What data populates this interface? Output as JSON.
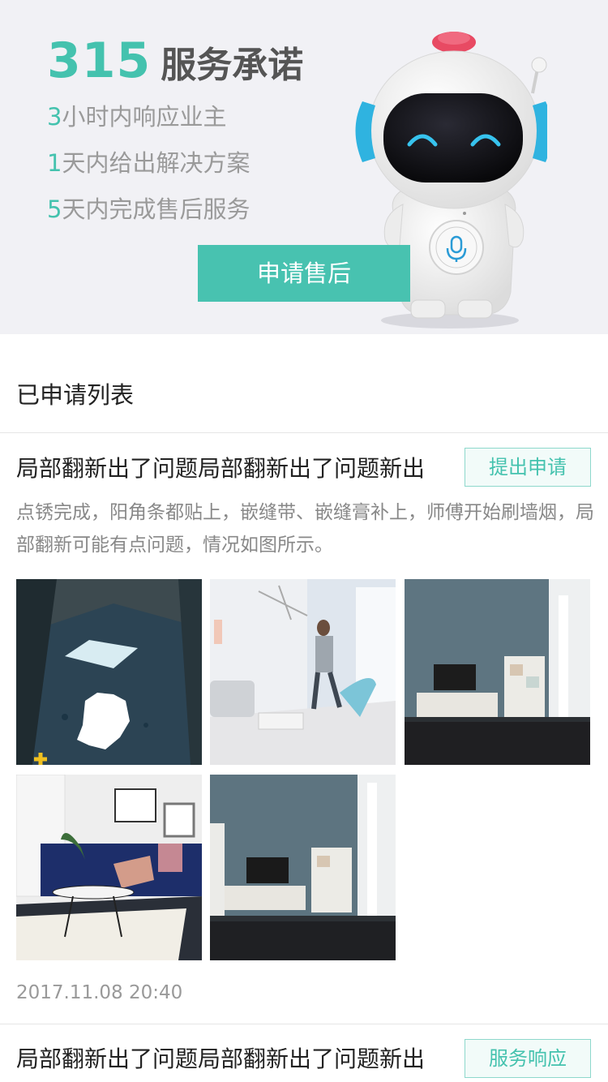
{
  "banner": {
    "promise_number": "315",
    "promise_word": "服务承诺",
    "lines": [
      {
        "num": "3",
        "text": "小时内响应业主"
      },
      {
        "num": "1",
        "text": "天内给出解决方案"
      },
      {
        "num": "5",
        "text": "天内完成售后服务"
      }
    ],
    "apply_button": "申请售后"
  },
  "list": {
    "title": "已申请列表",
    "items": [
      {
        "title": "局部翻新出了问题局部翻新出了问题新出",
        "action": "提出申请",
        "description": "点锈完成，阳角条都贴上，嵌缝带、嵌缝膏补上，师傅开始刷墙烟，局部翻新可能有点问题，情况如图所示。",
        "time": "2017.11.08 20:40"
      },
      {
        "title": "局部翻新出了问题局部翻新出了问题新出",
        "action": "服务响应"
      }
    ]
  },
  "colors": {
    "accent": "#48c2b0",
    "banner_bg": "#f1f1f5"
  },
  "icons": {
    "robot": "robot-mascot-icon",
    "mic": "microphone-icon"
  }
}
